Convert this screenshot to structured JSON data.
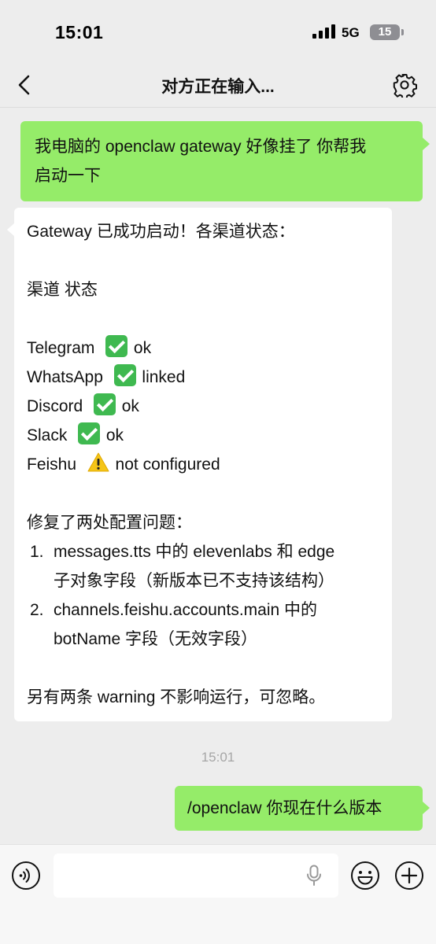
{
  "status_bar": {
    "time": "15:01",
    "network": "5G",
    "battery": "15"
  },
  "nav": {
    "title": "对方正在输入..."
  },
  "messages": {
    "m1": {
      "line1": "我电脑的 openclaw gateway 好像挂了 你帮我",
      "line2": "启动一下"
    },
    "m2": {
      "intro": "Gateway 已成功启动！各渠道状态：",
      "table_header": "渠道  状态",
      "channels": [
        {
          "name": "Telegram",
          "icon": "check-mark-icon",
          "status": "ok"
        },
        {
          "name": "WhatsApp",
          "icon": "check-mark-icon",
          "status": "linked"
        },
        {
          "name": "Discord",
          "icon": "check-mark-icon",
          "status": "ok"
        },
        {
          "name": "Slack",
          "icon": "check-mark-icon",
          "status": "ok"
        },
        {
          "name": "Feishu",
          "icon": "warning-icon",
          "status": "not configured"
        }
      ],
      "fix_heading": "修复了两处配置问题：",
      "fixes": [
        {
          "num": "1.",
          "line1": "messages.tts 中的 elevenlabs 和 edge",
          "line2": "子对象字段（新版本已不支持该结构）"
        },
        {
          "num": "2.",
          "line1": "channels.feishu.accounts.main 中的",
          "line2": "botName 字段（无效字段）"
        }
      ],
      "footer": "另有两条 warning 不影响运行，可忽略。"
    },
    "timestamp": "15:01",
    "m3": {
      "text": "/openclaw 你现在什么版本"
    }
  },
  "colors": {
    "outgoing_bubble": "#95ec69",
    "incoming_bubble": "#ffffff",
    "background": "#ededed"
  }
}
